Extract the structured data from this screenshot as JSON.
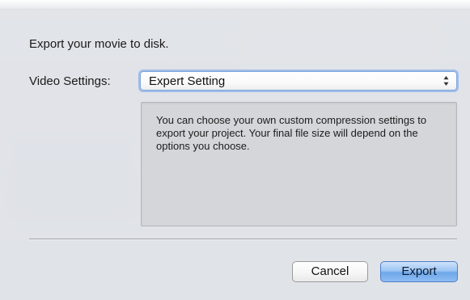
{
  "dialog": {
    "heading": "Export your movie to disk.",
    "video_settings": {
      "label": "Video Settings:",
      "selected": "Expert Setting",
      "arrow_icon": "up-down-arrows-icon"
    },
    "description": "You can choose your own custom compression settings to export your project. Your final file size will depend on the options you choose.",
    "buttons": {
      "cancel": "Cancel",
      "export": "Export"
    }
  },
  "colors": {
    "accent": "#6ea7ea",
    "focus_ring": "#6c9ee6",
    "sheet_bg": "#e2e4e8"
  }
}
